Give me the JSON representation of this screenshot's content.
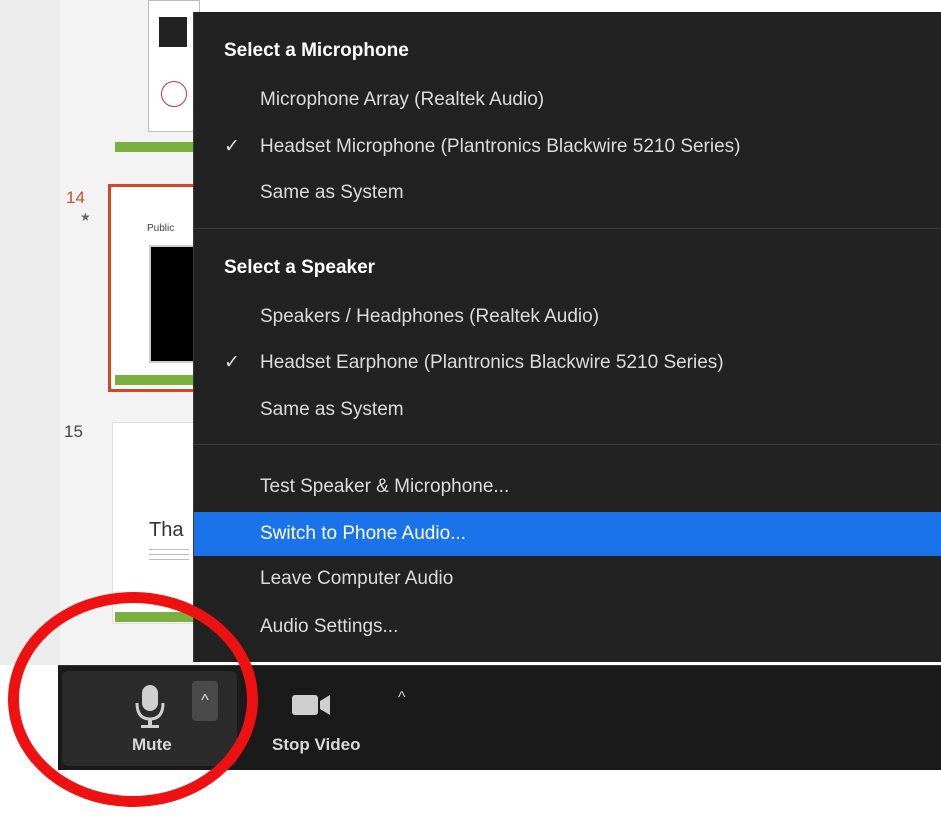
{
  "slides": {
    "numbers": [
      "14",
      "15"
    ],
    "star": "★",
    "thumb14_text": "Public",
    "thumb15_text": "Tha"
  },
  "menu": {
    "microphone_header": "Select a Microphone",
    "microphones": [
      {
        "label": "Microphone Array (Realtek Audio)",
        "selected": false
      },
      {
        "label": "Headset Microphone (Plantronics Blackwire 5210 Series)",
        "selected": true
      },
      {
        "label": "Same as System",
        "selected": false
      }
    ],
    "speaker_header": "Select a Speaker",
    "speakers": [
      {
        "label": "Speakers / Headphones (Realtek Audio)",
        "selected": false
      },
      {
        "label": "Headset Earphone (Plantronics Blackwire 5210 Series)",
        "selected": true
      },
      {
        "label": "Same as System",
        "selected": false
      }
    ],
    "actions": [
      {
        "label": "Test Speaker & Microphone...",
        "highlighted": false
      },
      {
        "label": "Switch to Phone Audio...",
        "highlighted": true
      },
      {
        "label": "Leave Computer Audio",
        "highlighted": false
      },
      {
        "label": "Audio Settings...",
        "highlighted": false
      }
    ],
    "check_glyph": "✓"
  },
  "toolbar": {
    "mute_label": "Mute",
    "video_label": "Stop Video",
    "caret_glyph": "^"
  },
  "colors": {
    "menu_bg": "#222222",
    "highlight": "#1a73e8",
    "annotation": "#ee1111",
    "slide_bar": "#78b13e"
  },
  "icons": {
    "microphone": "microphone-icon",
    "video": "video-camera-icon",
    "check": "checkmark-icon",
    "caret": "caret-up-icon"
  }
}
